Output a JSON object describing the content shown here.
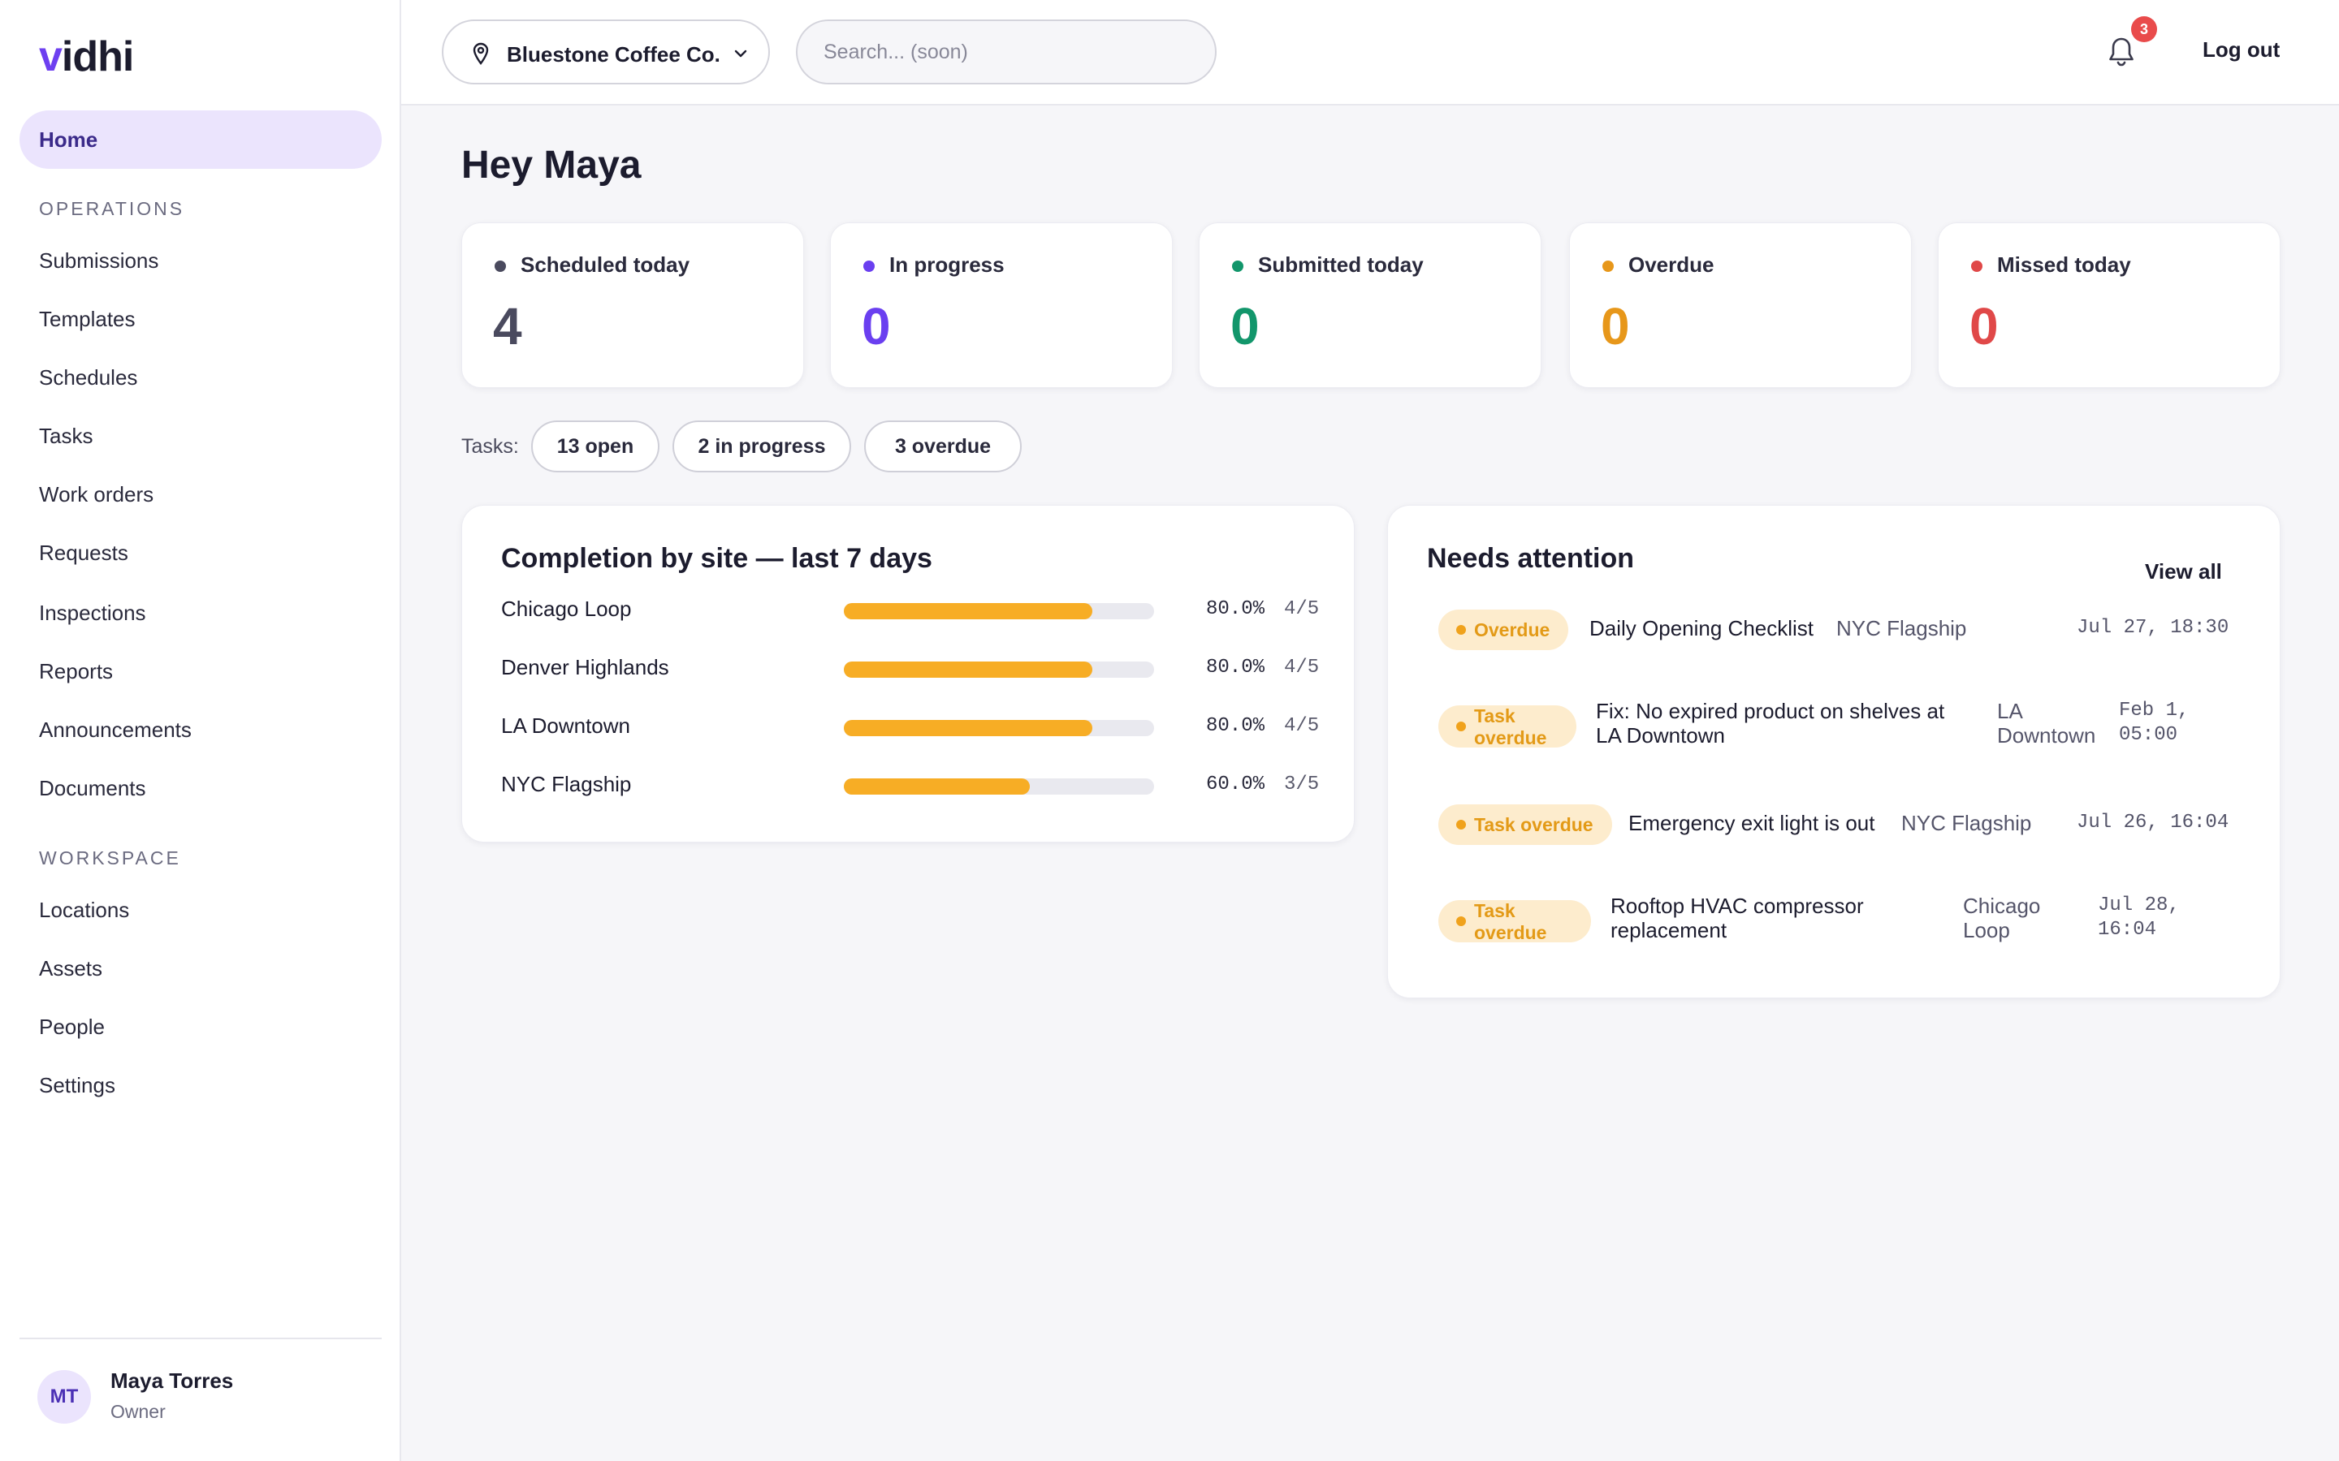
{
  "brand": {
    "logo_v": "v",
    "logo_rest": "idhi"
  },
  "sidebar": {
    "home": "Home",
    "section_operations": "OPERATIONS",
    "operations": [
      "Submissions",
      "Templates",
      "Schedules",
      "Tasks",
      "Work orders",
      "Requests",
      "Inspections",
      "Reports",
      "Announcements",
      "Documents"
    ],
    "section_workspace": "WORKSPACE",
    "workspace": [
      "Locations",
      "Assets",
      "People",
      "Settings"
    ],
    "user": {
      "initials": "MT",
      "name": "Maya Torres",
      "role": "Owner"
    }
  },
  "topbar": {
    "org": "Bluestone Coffee Co.",
    "search_placeholder": "Search... (soon)",
    "notifications_count": "3",
    "logout": "Log out"
  },
  "greeting": "Hey Maya",
  "stats": [
    {
      "label": "Scheduled today",
      "value": "4",
      "color": "#4a4a5e"
    },
    {
      "label": "In progress",
      "value": "0",
      "color": "#6a3ff0"
    },
    {
      "label": "Submitted today",
      "value": "0",
      "color": "#12966b"
    },
    {
      "label": "Overdue",
      "value": "0",
      "color": "#e7971a"
    },
    {
      "label": "Missed today",
      "value": "0",
      "color": "#e04848"
    }
  ],
  "tasks": {
    "label": "Tasks:",
    "pills": [
      "13 open",
      "2 in progress",
      "3 overdue"
    ]
  },
  "completion": {
    "title": "Completion by site — last 7 days",
    "sites": [
      {
        "name": "Chicago Loop",
        "fraction": 0.8,
        "pct": "80.0%",
        "ratio": "4/5"
      },
      {
        "name": "Denver Highlands",
        "fraction": 0.8,
        "pct": "80.0%",
        "ratio": "4/5"
      },
      {
        "name": "LA Downtown",
        "fraction": 0.8,
        "pct": "80.0%",
        "ratio": "4/5"
      },
      {
        "name": "NYC Flagship",
        "fraction": 0.6,
        "pct": "60.0%",
        "ratio": "3/5"
      }
    ]
  },
  "attention": {
    "title": "Needs attention",
    "view_all": "View all",
    "items": [
      {
        "badge": "Overdue",
        "title": "Daily Opening Checklist",
        "site": "NYC Flagship",
        "time": "Jul 27, 18:30"
      },
      {
        "badge_line1": "Task",
        "badge_line2": "overdue",
        "title_line1": "Fix: No expired product on shelves at",
        "title_line2": "LA Downtown",
        "site_line1": "LA",
        "site_line2": "Downtown",
        "time_line1": "Feb 1,",
        "time_line2": "05:00"
      },
      {
        "badge": "Task overdue",
        "title": "Emergency exit light is out",
        "site": "NYC Flagship",
        "time": "Jul 26, 16:04"
      },
      {
        "badge_line1": "Task",
        "badge_line2": "overdue",
        "title_line1": "Rooftop HVAC compressor",
        "title_line2": "replacement",
        "site_line1": "Chicago",
        "site_line2": "Loop",
        "time_line1": "Jul 28,",
        "time_line2": "16:04"
      }
    ]
  }
}
